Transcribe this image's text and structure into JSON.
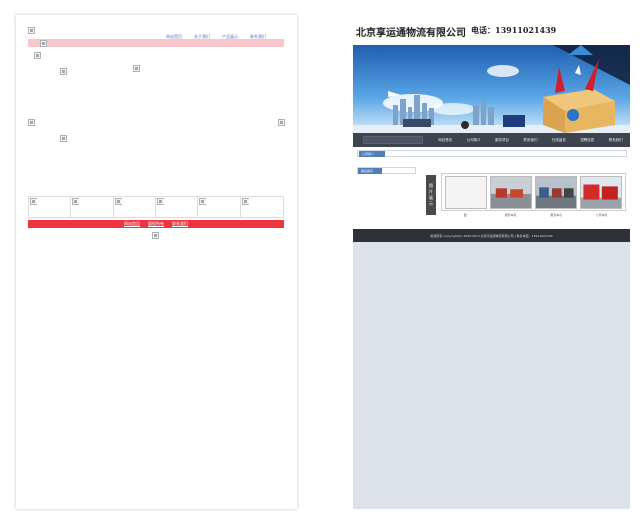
{
  "left": {
    "top_links": [
      "网站首页",
      "关于我们",
      "产品展示",
      "联系我们"
    ],
    "footer_links": [
      "网站首页",
      "版权所有",
      "联系我们"
    ]
  },
  "right": {
    "company_name": "北京享运通物流有限公司",
    "phone": "电话：13911021439",
    "nav_items": [
      "网站首页",
      "公司简介",
      "服务项目",
      "联系我们",
      "在线留言",
      "招聘信息",
      "联系我们"
    ],
    "section_tag_1": "公司简介",
    "section_tag_2": "联系我们",
    "side_label": [
      "图",
      "片",
      "展",
      "示"
    ],
    "thumb_captions": [
      "图",
      "服务车队",
      "服务车队",
      "公司车队"
    ],
    "footer_text": "版权所有 Copyright(C) 2009-2014 北京享运通物流有限公司 | 联系电话：13911021439"
  },
  "colors": {
    "pink_bar": "#f7c6cc",
    "red_bar": "#ec3540",
    "nav_bg": "#3d4450",
    "footer_bg": "#2e3138",
    "gray_area": "#dde1e8",
    "tag_blue": "#4e7fb8"
  }
}
